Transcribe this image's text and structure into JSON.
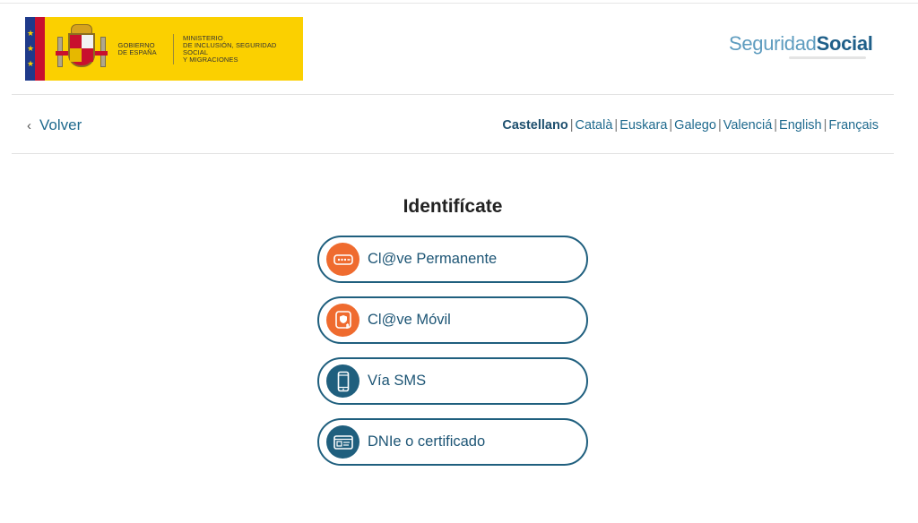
{
  "header": {
    "gov_line1": "GOBIERNO",
    "gov_line2": "DE ESPAÑA",
    "ministry_line1": "MINISTERIO",
    "ministry_line2": "DE INCLUSIÓN, SEGURIDAD SOCIAL",
    "ministry_line3": "Y MIGRACIONES",
    "ss_logo_light": "Seguridad",
    "ss_logo_bold": "Social",
    "colors": {
      "gov_yellow": "#fbd000",
      "eu_blue": "#1f3a8a",
      "ss_dark": "#1f5f89",
      "ss_light": "#5e9cbf"
    }
  },
  "nav": {
    "back_label": "Volver",
    "back_icon": "chevron-left-icon",
    "languages": [
      {
        "label": "Castellano",
        "active": true
      },
      {
        "label": "Català",
        "active": false
      },
      {
        "label": "Euskara",
        "active": false
      },
      {
        "label": "Galego",
        "active": false
      },
      {
        "label": "Valenciá",
        "active": false
      },
      {
        "label": "English",
        "active": false
      },
      {
        "label": "Français",
        "active": false
      }
    ],
    "separator": "|"
  },
  "main": {
    "title": "Identifícate",
    "options": [
      {
        "label": "Cl@ve Permanente",
        "icon": "password-field-icon",
        "color": "#ef6b2f"
      },
      {
        "label": "Cl@ve Móvil",
        "icon": "mobile-touch-icon",
        "color": "#ef6b2f"
      },
      {
        "label": "Vía SMS",
        "icon": "smartphone-icon",
        "color": "#1f5f7e"
      },
      {
        "label": "DNIe o certificado",
        "icon": "id-card-icon",
        "color": "#1f5f7e"
      }
    ],
    "colors": {
      "border": "#1f5f7e",
      "text": "#1d5575"
    }
  }
}
